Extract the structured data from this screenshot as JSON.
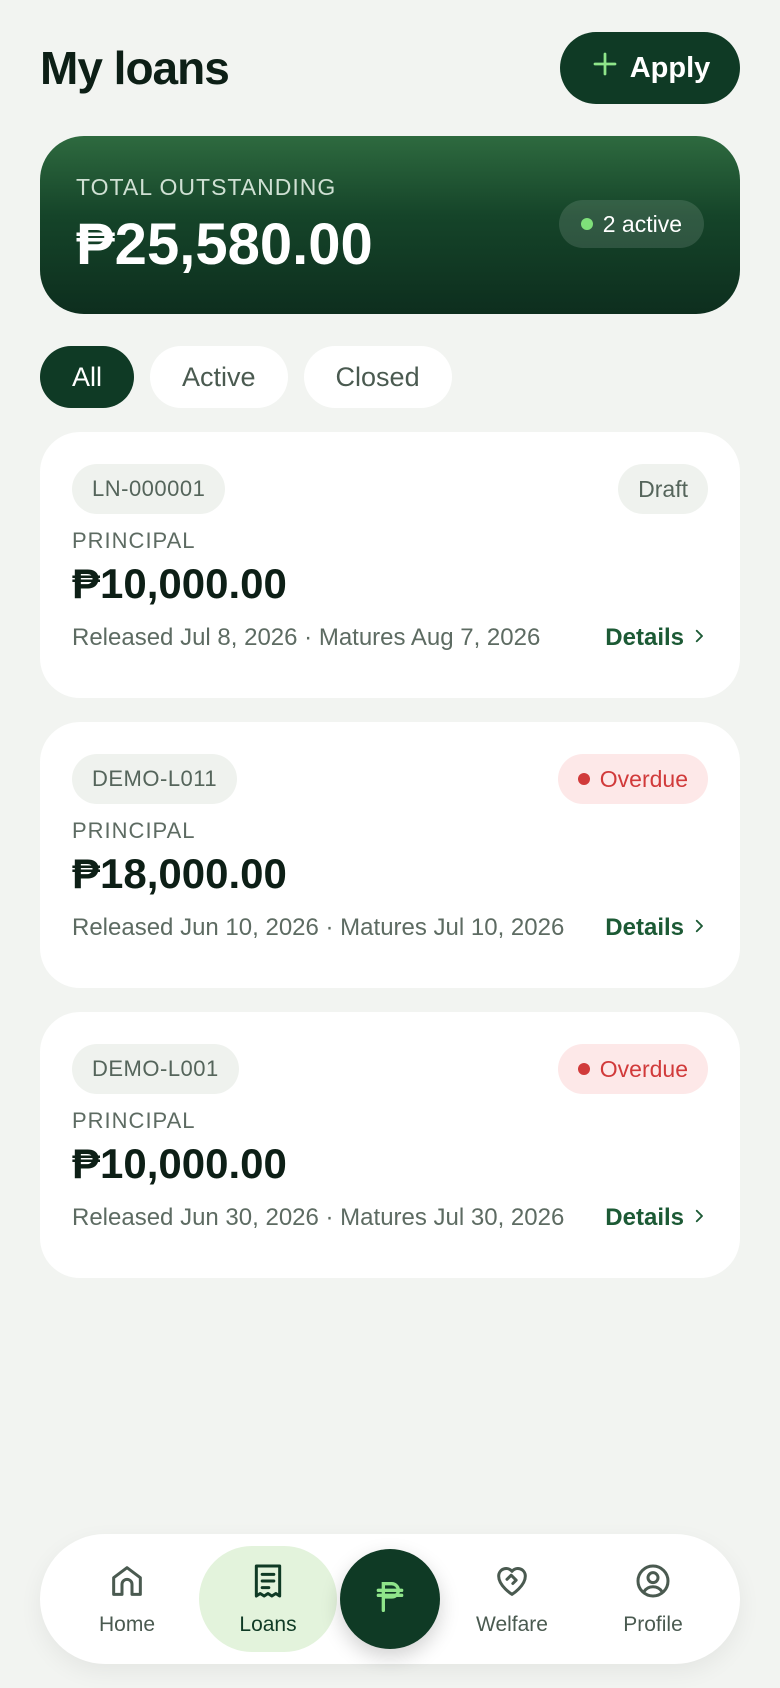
{
  "header": {
    "title": "My loans",
    "apply_label": "Apply"
  },
  "summary": {
    "label": "TOTAL OUTSTANDING",
    "amount": "₱25,580.00",
    "active_badge": "2 active"
  },
  "tabs": [
    {
      "label": "All",
      "selected": true
    },
    {
      "label": "Active",
      "selected": false
    },
    {
      "label": "Closed",
      "selected": false
    }
  ],
  "loans": [
    {
      "id": "LN-000001",
      "status": "Draft",
      "principal_label": "PRINCIPAL",
      "principal": "₱10,000.00",
      "dates": "Released Jul 8, 2026 · Matures Aug 7, 2026",
      "details_label": "Details"
    },
    {
      "id": "DEMO-L011",
      "status": "Overdue",
      "principal_label": "PRINCIPAL",
      "principal": "₱18,000.00",
      "dates": "Released Jun 10, 2026 · Matures Jul 10, 2026",
      "details_label": "Details"
    },
    {
      "id": "DEMO-L001",
      "status": "Overdue",
      "principal_label": "PRINCIPAL",
      "principal": "₱10,000.00",
      "dates": "Released Jun 30, 2026 · Matures Jul 30, 2026",
      "details_label": "Details"
    }
  ],
  "nav": {
    "home": "Home",
    "loans": "Loans",
    "welfare": "Welfare",
    "profile": "Profile",
    "active_item": "loans"
  },
  "colors": {
    "brand": "#0f3a25",
    "accent": "#7fe07a",
    "overdue": "#d13a3a",
    "background": "#f2f4f1"
  },
  "icons": {
    "apply": "plus-icon",
    "details": "chevron-right-icon",
    "home": "home-icon",
    "loans": "receipt-icon",
    "center": "peso-icon",
    "welfare": "heart-handshake-icon",
    "profile": "user-circle-icon"
  }
}
